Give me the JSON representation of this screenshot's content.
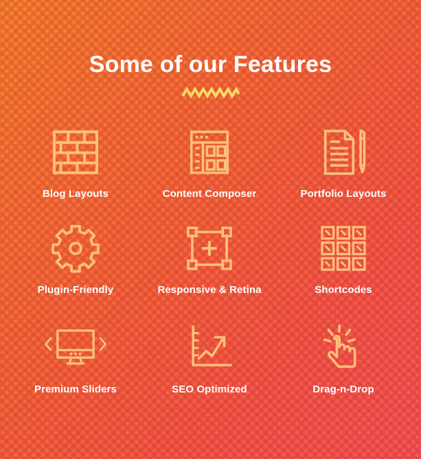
{
  "section": {
    "title": "Some of our Features",
    "divider_icon": "zigzag-divider"
  },
  "colors": {
    "gradient_start": "#FB8432",
    "gradient_end": "#F9565A",
    "icon_stroke": "#FBC07A",
    "label_text": "#FFFFFF",
    "divider": "#F7D967"
  },
  "features": [
    {
      "label": "Blog Layouts",
      "icon": "brick-wall-icon"
    },
    {
      "label": "Content Composer",
      "icon": "page-layout-icon"
    },
    {
      "label": "Portfolio Layouts",
      "icon": "document-pen-icon"
    },
    {
      "label": "Plugin-Friendly",
      "icon": "gear-icon"
    },
    {
      "label": "Responsive & Retina",
      "icon": "resize-box-icon"
    },
    {
      "label": "Shortcodes",
      "icon": "grid-3x3-icon"
    },
    {
      "label": "Premium Sliders",
      "icon": "monitor-arrows-icon"
    },
    {
      "label": "SEO Optimized",
      "icon": "growth-chart-icon"
    },
    {
      "label": "Drag-n-Drop",
      "icon": "click-hand-icon"
    }
  ]
}
